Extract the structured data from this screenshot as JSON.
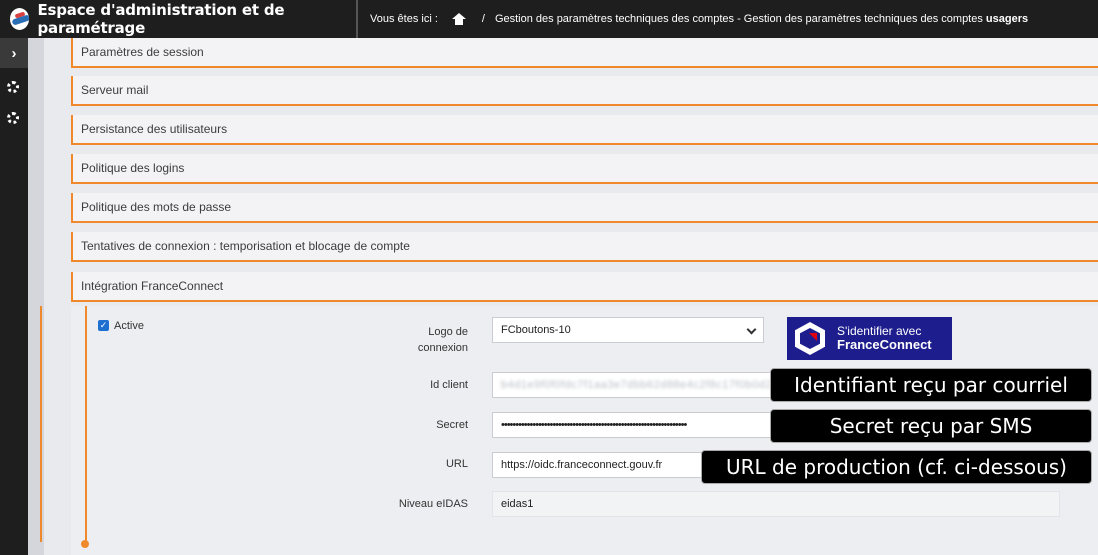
{
  "header": {
    "title": "Espace d'administration et de paramétrage",
    "breadcrumb_label": "Vous êtes ici :",
    "breadcrumb_separator": "/",
    "breadcrumb_path": "Gestion des paramètres techniques des comptes - Gestion des paramètres techniques des comptes",
    "breadcrumb_current": "usagers"
  },
  "sidebar": {
    "toggle_glyph": "›"
  },
  "panels": [
    {
      "label": "Paramètres de session"
    },
    {
      "label": "Serveur mail"
    },
    {
      "label": "Persistance des utilisateurs"
    },
    {
      "label": "Politique des logins"
    },
    {
      "label": "Politique des mots de passe"
    },
    {
      "label": "Tentatives de connexion : temporisation et blocage de compte"
    },
    {
      "label": "Intégration FranceConnect"
    }
  ],
  "franceconnect": {
    "active_label": "Active",
    "logo_label_line1": "Logo de",
    "logo_label_line2": "connexion",
    "logo_value": "FCboutons-10",
    "id_client_label": "Id client",
    "id_client_value": "b4d1e9f0f0fdc7f1aa3e7dbb62d88e4c2f8c17f0b0d27e0c",
    "secret_label": "Secret",
    "secret_value": "•••••••••••••••••••••••••••••••••••••••••••••••••••••••••••••••••",
    "url_label": "URL",
    "url_value": "https://oidc.franceconnect.gouv.fr",
    "eidas_label": "Niveau eIDAS",
    "eidas_value": "eidas1",
    "button_line1": "S'identifier avec",
    "button_line2": "FranceConnect",
    "brand_color": "#1d1d8e",
    "accent_color": "#f0882c"
  },
  "callouts": {
    "id_client": "Identifiant reçu par courriel",
    "secret": "Secret reçu par SMS",
    "url": "URL de production (cf. ci-dessous)"
  }
}
